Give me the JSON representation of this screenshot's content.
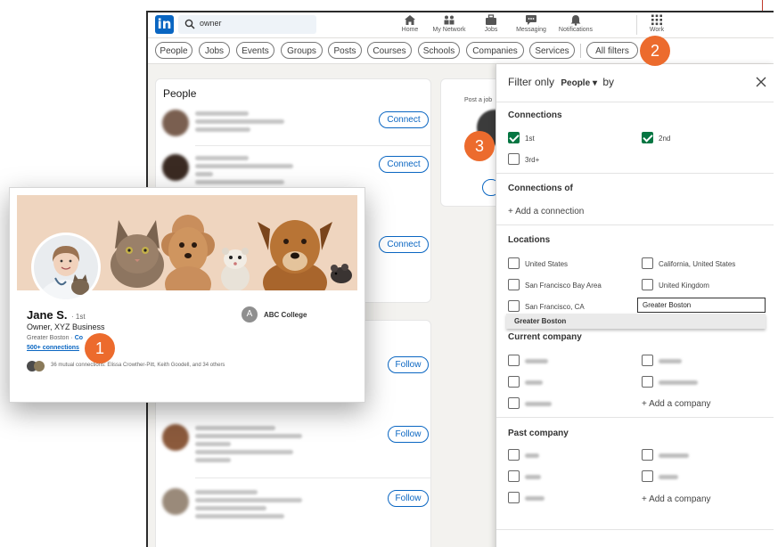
{
  "topbar": {
    "logo": "in",
    "search_value": "owner",
    "nav": [
      {
        "label": "Home",
        "icon": "home-icon"
      },
      {
        "label": "My Network",
        "icon": "network-icon"
      },
      {
        "label": "Jobs",
        "icon": "briefcase-icon"
      },
      {
        "label": "Messaging",
        "icon": "message-icon"
      },
      {
        "label": "Notifications",
        "icon": "bell-icon"
      },
      {
        "label": "Work",
        "icon": "grid-icon"
      }
    ]
  },
  "filter_pills": [
    "People",
    "Jobs",
    "Events",
    "Groups",
    "Posts",
    "Courses",
    "Schools",
    "Companies",
    "Services",
    "All filters"
  ],
  "people": {
    "title": "People",
    "buttons": [
      "Connect",
      "Connect",
      "Connect",
      "Follow",
      "Follow",
      "Follow"
    ]
  },
  "mid_card": {
    "text": "Post a job"
  },
  "panel": {
    "title_prefix": "Filter only",
    "title_select": "People",
    "title_suffix": "by",
    "connections": {
      "heading": "Connections",
      "options": [
        {
          "label": "1st",
          "checked": true
        },
        {
          "label": "2nd",
          "checked": true
        },
        {
          "label": "3rd+",
          "checked": false
        }
      ]
    },
    "connections_of": {
      "heading": "Connections of",
      "add": "+ Add a connection"
    },
    "locations": {
      "heading": "Locations",
      "options": [
        "United States",
        "California, United States",
        "San Francisco Bay Area",
        "United Kingdom",
        "San Francisco, CA"
      ],
      "input_value": "Greater Boston",
      "suggestion": "Greater Boston"
    },
    "current_company": {
      "heading": "Current company",
      "add": "+ Add a company"
    },
    "past_company": {
      "heading": "Past company",
      "add": "+ Add a company"
    }
  },
  "profile_card": {
    "name": "Jane S.",
    "degree": "· 1st",
    "headline": "Owner, XYZ Business",
    "location": "Greater Boston",
    "location_sep": "·",
    "contact_link": "Co",
    "connections": "500+ connections",
    "mutual": "36 mutual connections: Elissa Crowther-Pitt, Keith Goodell, and 34 others",
    "school_initial": "A",
    "school": "ABC College"
  },
  "badges": [
    "1",
    "2",
    "3"
  ],
  "colors": {
    "brand": "#0a66c2",
    "badge": "#ec6b2d",
    "checked": "#057642"
  }
}
